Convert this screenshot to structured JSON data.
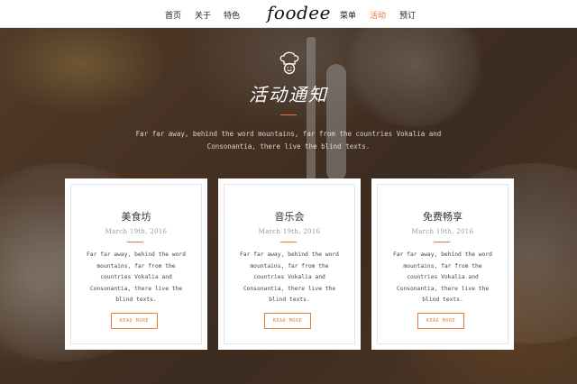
{
  "nav": {
    "left_items": [
      "首页",
      "关于",
      "特色"
    ],
    "brand": "foodee",
    "right_items": [
      "菜单",
      "活动",
      "预订"
    ],
    "active_item": "活动"
  },
  "hero": {
    "title": "活动通知",
    "intro": "Far far away, behind the word mountains, far from the countries Vokalia and Consonantia, there live the blind texts."
  },
  "events": [
    {
      "title": "美食坊",
      "date": "March 19th, 2016",
      "text": "Far far away, behind the word mountains, far from the countries Vokalia and Consonantia, there live the blind texts.",
      "button": "READ MORE"
    },
    {
      "title": "音乐会",
      "date": "March 19th, 2016",
      "text": "Far far away, behind the word mountains, far from the countries Vokalia and Consonantia, there live the blind texts.",
      "button": "READ MORE"
    },
    {
      "title": "免费畅享",
      "date": "March 19th, 2016",
      "text": "Far far away, behind the word mountains, far from the countries Vokalia and Consonantia, there live the blind texts.",
      "button": "READ MORE"
    }
  ],
  "icons": {
    "hero": "chef-hat-icon"
  },
  "colors": {
    "accent": "#e8792e",
    "nav_text": "#222222",
    "card_bg": "#ffffff"
  }
}
